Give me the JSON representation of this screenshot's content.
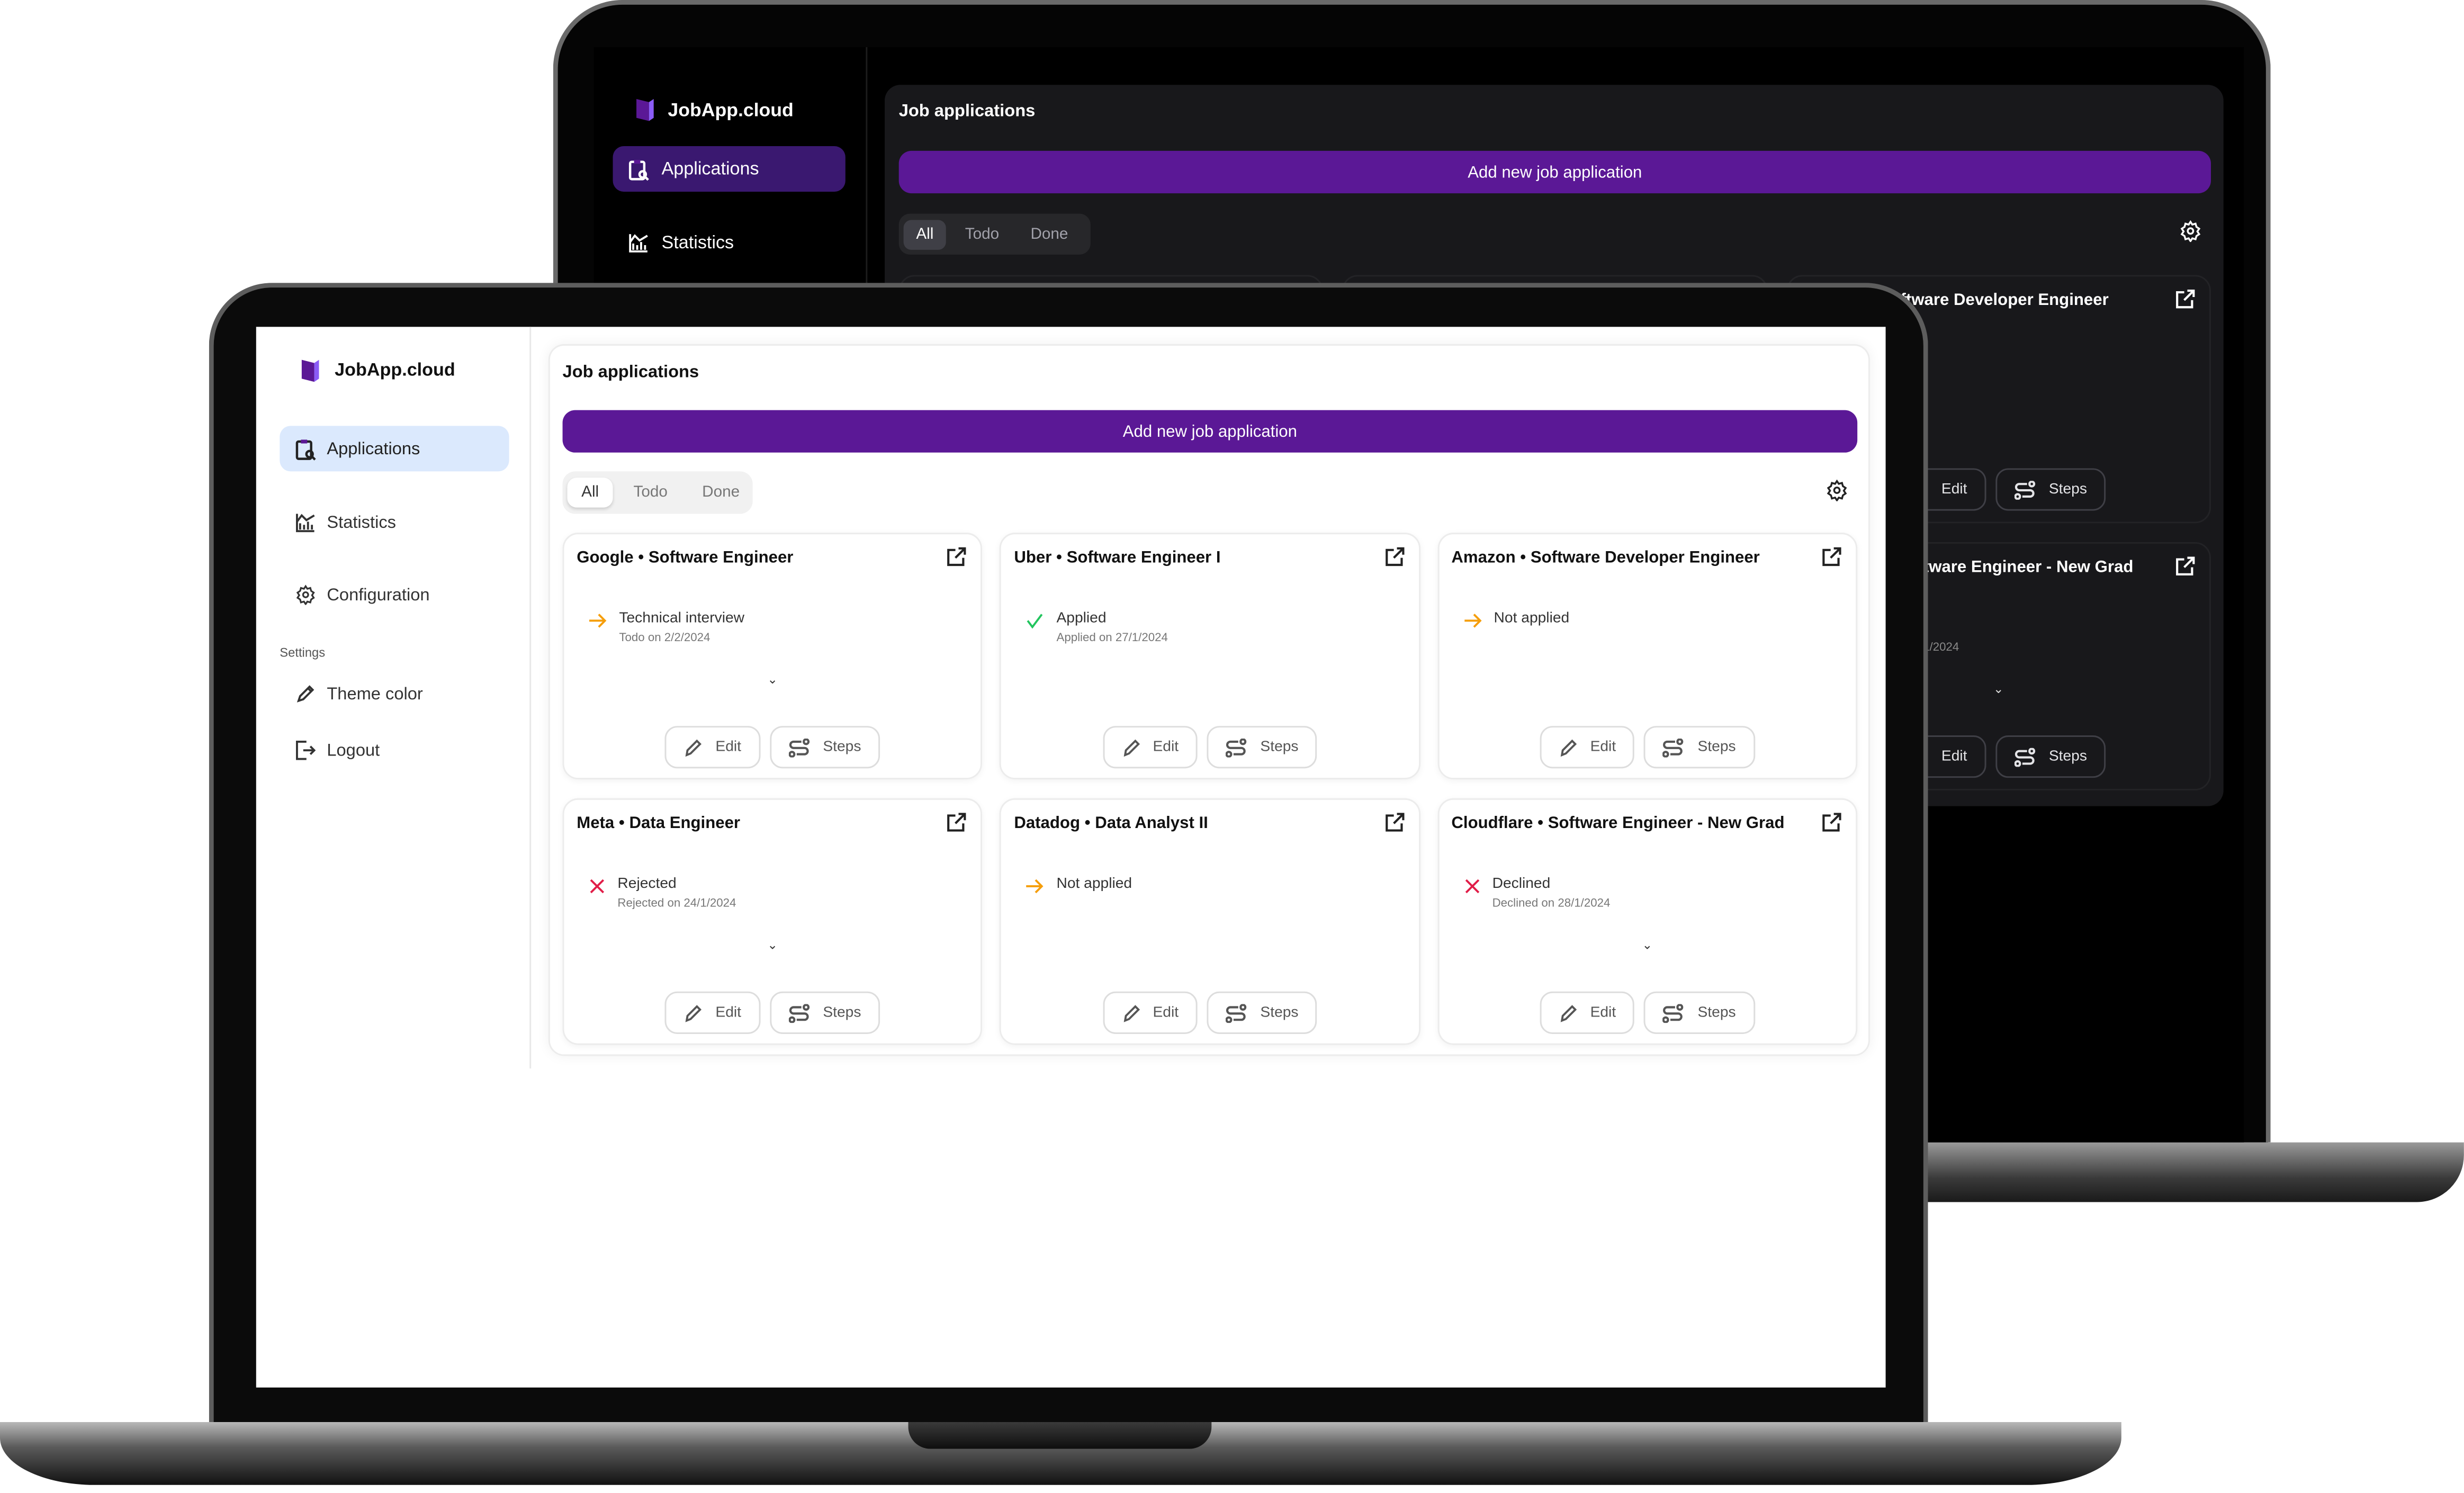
{
  "app": {
    "name": "JobApp.cloud",
    "brand_color": "#5b1896"
  },
  "sidebar": {
    "items": [
      {
        "label": "Applications",
        "icon": "clipboard-search-icon",
        "active": true
      },
      {
        "label": "Statistics",
        "icon": "chart-icon"
      },
      {
        "label": "Configuration",
        "icon": "gear-icon"
      }
    ],
    "settings_label": "Settings",
    "settings_items": [
      {
        "label": "Theme color",
        "icon": "pipette-icon"
      },
      {
        "label": "Logout",
        "icon": "logout-icon"
      }
    ]
  },
  "main": {
    "title": "Job applications",
    "add_button": "Add new job application",
    "tabs": [
      {
        "label": "All",
        "active": true
      },
      {
        "label": "Todo"
      },
      {
        "label": "Done"
      }
    ],
    "edit_label": "Edit",
    "steps_label": "Steps",
    "cards": [
      {
        "title": "Google • Software Engineer",
        "status": "Technical interview",
        "date": "Todo on 2/2/2024",
        "icon": "arrow-right-icon",
        "icon_color": "#f59e0b",
        "expandable": true
      },
      {
        "title": "Uber • Software Engineer I",
        "status": "Applied",
        "date": "Applied on 27/1/2024",
        "icon": "check-icon",
        "icon_color": "#22c55e",
        "expandable": false
      },
      {
        "title": "Amazon • Software Developer Engineer",
        "status": "Not applied",
        "date": "",
        "icon": "arrow-right-icon",
        "icon_color": "#f59e0b",
        "expandable": false
      },
      {
        "title": "Meta • Data Engineer",
        "status": "Rejected",
        "date": "Rejected on 24/1/2024",
        "icon": "x-icon",
        "icon_color": "#e11d48",
        "expandable": true
      },
      {
        "title": "Datadog • Data Analyst II",
        "status": "Not applied",
        "date": "",
        "icon": "arrow-right-icon",
        "icon_color": "#f59e0b",
        "expandable": false
      },
      {
        "title": "Cloudflare • Software Engineer - New Grad",
        "status": "Declined",
        "date": "Declined on 28/1/2024",
        "icon": "x-icon",
        "icon_color": "#e11d48",
        "expandable": true
      }
    ]
  }
}
